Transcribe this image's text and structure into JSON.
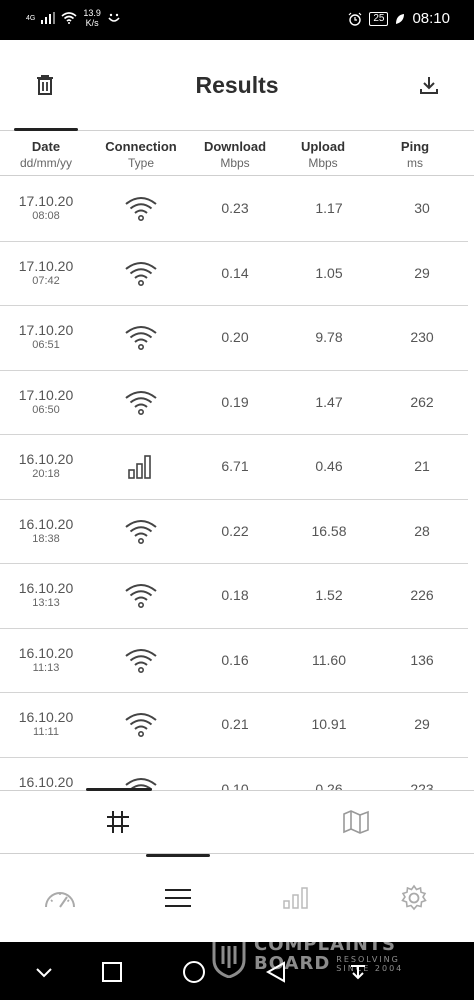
{
  "status_bar": {
    "network": "4G",
    "speed_value": "13.9",
    "speed_unit": "K/s",
    "battery": "25",
    "time": "08:10"
  },
  "header": {
    "title": "Results",
    "left_icon": "trash-icon",
    "right_icon": "download-icon"
  },
  "columns": [
    {
      "title": "Date",
      "sub": "dd/mm/yy"
    },
    {
      "title": "Connection",
      "sub": "Type"
    },
    {
      "title": "Download",
      "sub": "Mbps"
    },
    {
      "title": "Upload",
      "sub": "Mbps"
    },
    {
      "title": "Ping",
      "sub": "ms"
    }
  ],
  "rows": [
    {
      "date": "17.10.20",
      "time": "08:08",
      "type": "wifi",
      "download": "0.23",
      "upload": "1.17",
      "ping": "30"
    },
    {
      "date": "17.10.20",
      "time": "07:42",
      "type": "wifi",
      "download": "0.14",
      "upload": "1.05",
      "ping": "29"
    },
    {
      "date": "17.10.20",
      "time": "06:51",
      "type": "wifi",
      "download": "0.20",
      "upload": "9.78",
      "ping": "230"
    },
    {
      "date": "17.10.20",
      "time": "06:50",
      "type": "wifi",
      "download": "0.19",
      "upload": "1.47",
      "ping": "262"
    },
    {
      "date": "16.10.20",
      "time": "20:18",
      "type": "cellular",
      "download": "6.71",
      "upload": "0.46",
      "ping": "21"
    },
    {
      "date": "16.10.20",
      "time": "18:38",
      "type": "wifi",
      "download": "0.22",
      "upload": "16.58",
      "ping": "28"
    },
    {
      "date": "16.10.20",
      "time": "13:13",
      "type": "wifi",
      "download": "0.18",
      "upload": "1.52",
      "ping": "226"
    },
    {
      "date": "16.10.20",
      "time": "11:13",
      "type": "wifi",
      "download": "0.16",
      "upload": "11.60",
      "ping": "136"
    },
    {
      "date": "16.10.20",
      "time": "11:11",
      "type": "wifi",
      "download": "0.21",
      "upload": "10.91",
      "ping": "29"
    },
    {
      "date": "16.10.20",
      "time": "",
      "type": "wifi",
      "download": "0.10",
      "upload": "0.26",
      "ping": "223"
    }
  ],
  "sub_tabs": [
    {
      "icon": "grid-icon",
      "active": true
    },
    {
      "icon": "map-icon",
      "active": false
    }
  ],
  "bottom_nav": [
    {
      "icon": "speedometer-icon",
      "active": false
    },
    {
      "icon": "menu-icon",
      "active": true
    },
    {
      "icon": "bar-chart-icon",
      "active": false
    },
    {
      "icon": "gear-icon",
      "active": false
    }
  ],
  "watermark": {
    "line1": "COMPLAINTS",
    "line2": "BOARD",
    "line3": "RESOLVING",
    "line4": "SINCE 2004"
  },
  "colors": {
    "text_dark": "#2e2e2e",
    "text_value": "#555555",
    "divider": "#d4d4d4",
    "indicator": "#222222"
  }
}
